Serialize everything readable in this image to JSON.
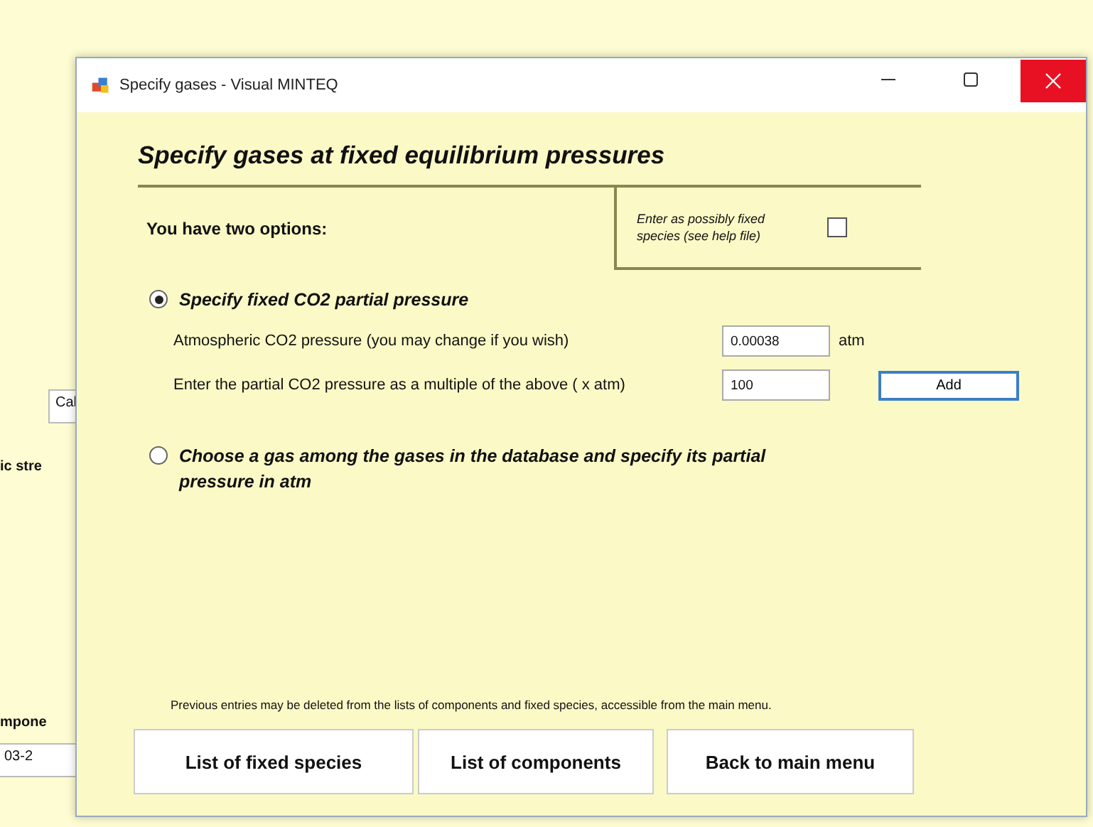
{
  "background_window": {
    "field_1": "Cal",
    "label_1": "ic stre",
    "label_2": "mpone",
    "field_2": "03-2"
  },
  "window": {
    "title": "Specify gases - Visual MINTEQ"
  },
  "heading": "Specify gases at fixed equilibrium pressures",
  "options_label": "You have two options:",
  "fixed_species": {
    "label": "Enter as possibly fixed species (see help file)",
    "checked": false
  },
  "options": [
    {
      "kind": "co2",
      "label": "Specify fixed CO2 partial pressure",
      "selected": true,
      "fields": [
        {
          "label": "Atmospheric CO2 pressure (you may change if you wish)",
          "value": "0.00038",
          "unit": "atm"
        },
        {
          "label": "Enter the partial CO2 pressure as a multiple of the above ( x atm)",
          "value": "100",
          "button": "Add"
        }
      ]
    },
    {
      "kind": "gas",
      "label": "Choose a gas among the gases in the database and specify its partial pressure in atm",
      "selected": false
    }
  ],
  "note": "Previous entries may be deleted from the lists of components and fixed species, accessible from the main menu.",
  "buttons": [
    "List of fixed species",
    "List of components",
    "Back to main menu"
  ]
}
